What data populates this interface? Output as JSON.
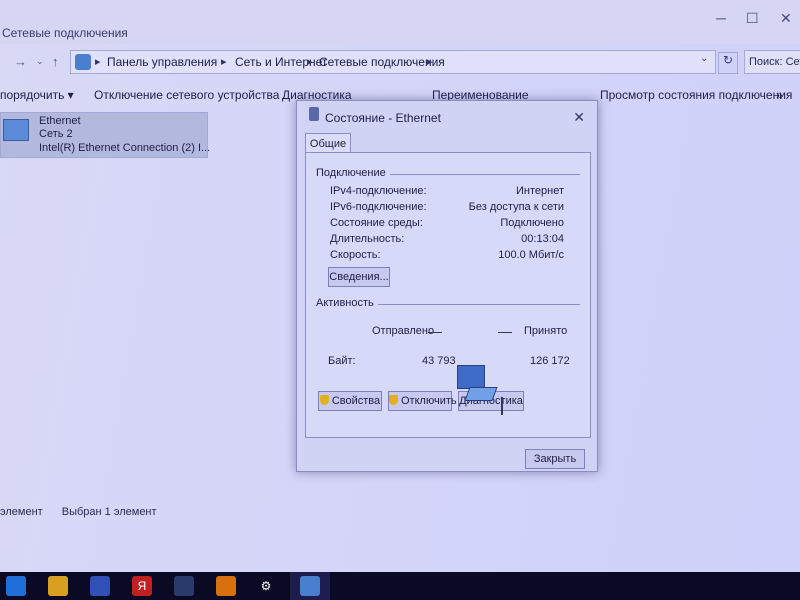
{
  "window": {
    "title": "Сетевые подключения",
    "controls": {
      "minimize": "─",
      "maximize": "☐",
      "close": "✕"
    }
  },
  "address": {
    "back": "←",
    "forward": "→",
    "recent": "⌄",
    "up": "↑",
    "breadcrumbs": [
      "Панель управления",
      "Сеть и Интернет",
      "Сетевые подключения"
    ],
    "separator": "▸",
    "dropdown": "⌄",
    "refresh": "↻",
    "search_placeholder": "Поиск: Сете"
  },
  "commands": {
    "organize": "порядочить ▾",
    "disable": "Отключение сетевого устройства",
    "diagnose": "Диагностика",
    "rename": "Переименование",
    "view_status": "Просмотр состояния подключения",
    "more": "»"
  },
  "adapter": {
    "name": "Ethernet",
    "network": "Сеть 2",
    "device": "Intel(R) Ethernet Connection (2) I..."
  },
  "statusbar": {
    "count": "элемент",
    "selected": "Выбран 1 элемент"
  },
  "dialog": {
    "title": "Состояние - Ethernet",
    "close": "✕",
    "tab": "Общие",
    "connection_group": "Подключение",
    "rows": [
      {
        "label": "IPv4-подключение:",
        "value": "Интернет"
      },
      {
        "label": "IPv6-подключение:",
        "value": "Без доступа к сети"
      },
      {
        "label": "Состояние среды:",
        "value": "Подключено"
      },
      {
        "label": "Длительность:",
        "value": "00:13:04"
      },
      {
        "label": "Скорость:",
        "value": "100.0 Мбит/с"
      }
    ],
    "details_button": "Сведения...",
    "activity_group": "Активность",
    "sent_label": "Отправлено",
    "received_label": "Принято",
    "bytes_label": "Байт:",
    "bytes_sent": "43 793",
    "bytes_received": "126 172",
    "properties_button": "Свойства",
    "disable_button": "Отключить",
    "diagnose_button": "Диагностика",
    "close_button": "Закрыть"
  },
  "taskbar": {
    "icons": [
      "windows-store-icon",
      "yandex-icon",
      "steam-icon",
      "vlc-icon",
      "settings-icon",
      "network-connections-icon"
    ],
    "yandex": "Я",
    "settings": "⚙"
  },
  "colors": {
    "dialog_bg": "#d1d3f5",
    "screen_tint": "#d4d5f8",
    "taskbar": "#0b0a24"
  }
}
